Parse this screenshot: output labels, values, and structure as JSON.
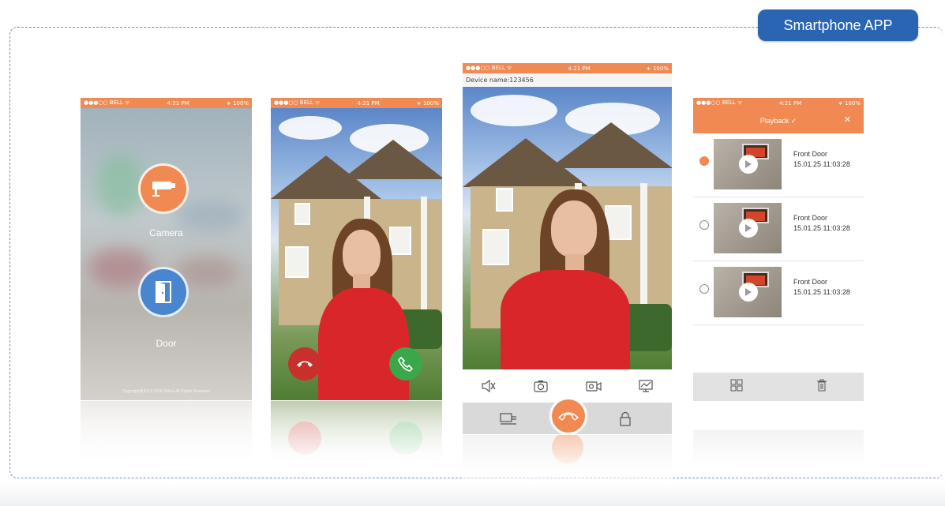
{
  "badge": {
    "label": "Smartphone APP"
  },
  "status_bar": {
    "carrier": "●●●○○ BELL ᯤ",
    "time": "4:21 PM",
    "battery": "∗ 100%"
  },
  "phone1": {
    "camera_label": "Camera",
    "door_label": "Door",
    "copyright": "Copyright@2013-2016 Doline All Rights Reserved",
    "camera_color": "#f08a52",
    "door_color": "#4a86cf"
  },
  "phone2": {
    "decline_color": "#c9302c",
    "accept_color": "#3aa84a"
  },
  "phone3": {
    "device_name": "Device name:123456",
    "toolbar_icons": [
      "mute-icon",
      "snapshot-icon",
      "record-icon",
      "monitor-icon"
    ],
    "action_icons": [
      "unlock-card-icon",
      "hangup-icon",
      "lock-icon"
    ]
  },
  "phone4": {
    "header_title": "Playback ✓",
    "close_label": "✕",
    "records": [
      {
        "title": "Front Door",
        "time": "15.01.25 11:03:28",
        "selected": true
      },
      {
        "title": "Front Door",
        "time": "15.01.25 11:03:28",
        "selected": false
      },
      {
        "title": "Front Door",
        "time": "15.01.25 11:03:28",
        "selected": false
      }
    ],
    "footer_icons": [
      "grid-icon",
      "trash-icon"
    ]
  },
  "colors": {
    "accent": "#f08a52",
    "badge": "#2a65b3",
    "frame": "#6a8fc7"
  }
}
